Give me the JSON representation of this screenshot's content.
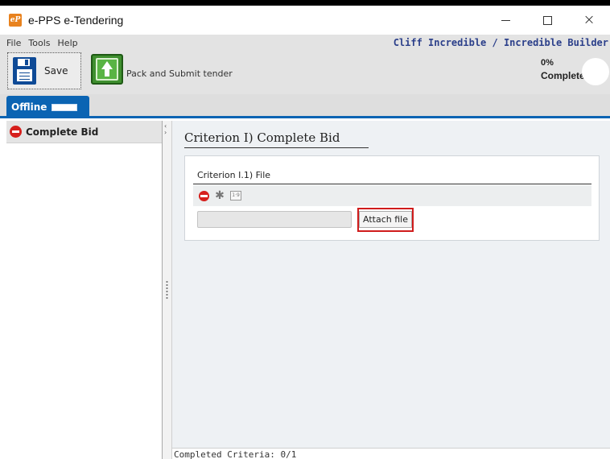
{
  "window": {
    "app_icon_text": "eP",
    "title": "e-PPS e-Tendering",
    "minimize": "minimize",
    "maximize": "maximize",
    "close_glyph": "×"
  },
  "menu": {
    "items": [
      "File",
      "Tools",
      "Help"
    ]
  },
  "user": {
    "name": "Cliff Incredible / Incredible Builder"
  },
  "toolbar": {
    "save_label": "Save",
    "pack_label": "Pack and Submit tender"
  },
  "progress": {
    "percent_text": "0%",
    "label": "Complete",
    "fraction": 0
  },
  "tabs": {
    "offline_label": "Offline"
  },
  "sidebar": {
    "items": [
      {
        "label": "Complete Bid",
        "status_icon": "stop-icon"
      }
    ]
  },
  "main": {
    "criterion_title": "Criterion I) Complete Bid",
    "sub_criterion_title": "Criterion I.1) File",
    "file_value": "",
    "attach_label": "Attach file",
    "icons": [
      "delete-icon",
      "puzzle-icon",
      "document-icon"
    ]
  },
  "status": {
    "text": "Completed Criteria: 0/1"
  },
  "colors": {
    "accent_blue": "#0b64b3",
    "user_name": "#2b3f8a",
    "stop_red": "#d6201d",
    "highlight_red": "#d01c1c",
    "pack_green": "#3f8f2f"
  }
}
